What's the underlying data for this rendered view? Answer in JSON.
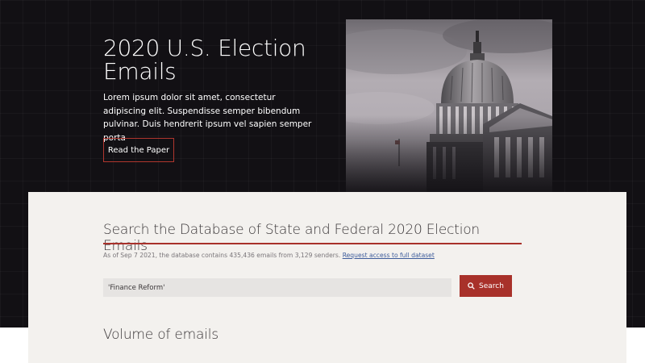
{
  "hero": {
    "title": "2020 U.S. Election Emails",
    "description": "Lorem ipsum dolor sit amet, consectetur adipiscing elit. Suspendisse semper bibendum pulvinar. Duis hendrerit ipsum vel sapien semper porta",
    "button_label": "Read the Paper",
    "image_icon": "capitol-building-photo"
  },
  "search_section": {
    "title": "Search the Database of State and Federal 2020 Election Emails",
    "info_text": "As of Sep 7 2021, the database contains 435,436 emails from 3,129 senders.",
    "info_link": "Request access to full dataset",
    "input_value": "'Finance Reform'",
    "search_label": "Search",
    "search_icon": "search-icon"
  },
  "volume_section": {
    "title": "Volume of emails"
  },
  "colors": {
    "hero_background": "#121014",
    "accent": "#a8312a",
    "card_background": "#f3f1ee",
    "link": "#3d5c9b"
  }
}
